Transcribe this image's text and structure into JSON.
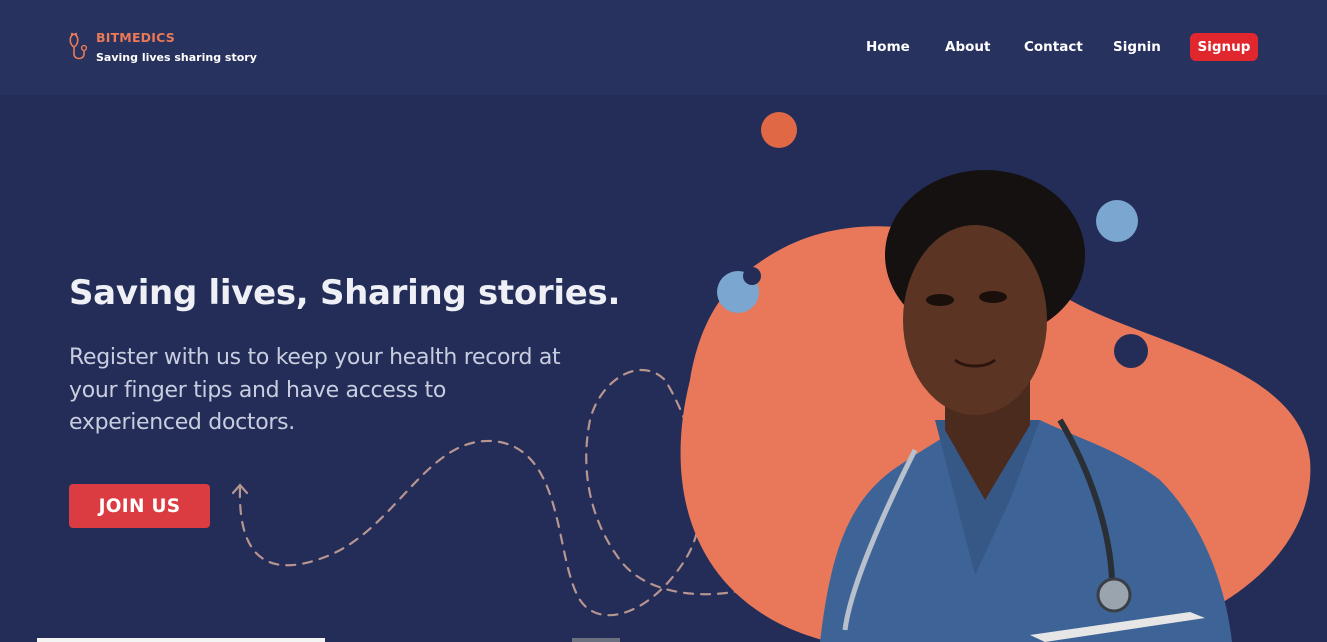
{
  "header": {
    "brand_name": "BITMEDICS",
    "brand_tagline": "Saving lives sharing story",
    "logo_icon": "stethoscope-icon",
    "nav": {
      "home": "Home",
      "about": "About",
      "contact": "Contact",
      "signin": "Signin",
      "signup": "Signup"
    }
  },
  "hero": {
    "title": "Saving lives, Sharing stories.",
    "subtitle": "Register with us to keep your health record at your finger tips and have access to experienced doctors.",
    "cta_label": "JOIN US",
    "image": "doctor-in-blue-scrubs-with-stethoscope"
  },
  "colors": {
    "background": "#232d57",
    "header_background": "#27325e",
    "brand_accent": "#ea7957",
    "signup_button": "#e0272e",
    "cta_button": "#da3c41",
    "blob": "#e9785a",
    "circle_blue": "#7aa6d0",
    "circle_orange": "#e06845"
  }
}
